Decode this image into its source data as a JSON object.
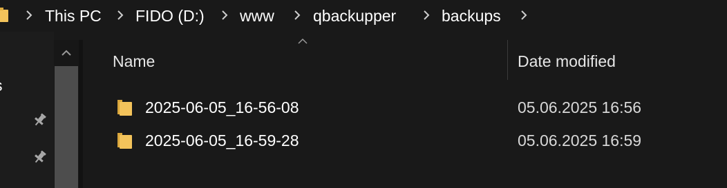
{
  "breadcrumb": {
    "items": [
      "This PC",
      "FIDO (D:)",
      "www",
      "qbackupper",
      "backups"
    ]
  },
  "navpane": {
    "cut_label": "s"
  },
  "filelist": {
    "columns": [
      "Name",
      "Date modified"
    ],
    "rows": [
      {
        "name": "2025-06-05_16-56-08",
        "date_modified": "05.06.2025 16:56"
      },
      {
        "name": "2025-06-05_16-59-28",
        "date_modified": "05.06.2025 16:59"
      }
    ]
  },
  "colors": {
    "background": "#191919",
    "folder": "#f3c35b",
    "text": "#ffffff",
    "scroll_thumb": "#4d4d4d"
  }
}
